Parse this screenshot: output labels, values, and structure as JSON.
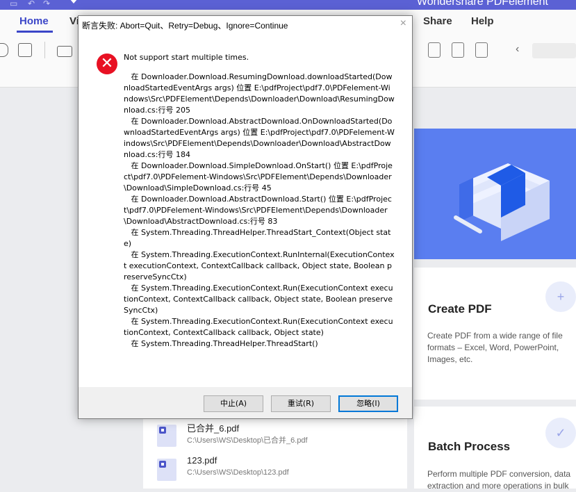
{
  "app": {
    "title": "Wondershare PDFelement"
  },
  "ribbon": {
    "tabs": [
      "Home",
      "Vi",
      "Share",
      "Help"
    ]
  },
  "recent_files": [
    {
      "name": "已合并_6.pdf",
      "path": "C:\\Users\\WS\\Desktop\\已合并_6.pdf"
    },
    {
      "name": "123.pdf",
      "path": "C:\\Users\\WS\\Desktop\\123.pdf"
    }
  ],
  "cards": {
    "create": {
      "title": "Create PDF",
      "desc": "Create PDF from a wide range of file formats – Excel, Word, PowerPoint, Images, etc."
    },
    "batch": {
      "title": "Batch Process",
      "desc": "Perform multiple PDF conversion, data extraction and more operations in bulk"
    }
  },
  "dialog": {
    "title": "断言失败: Abort=Quit、Retry=Debug、Ignore=Continue",
    "message": "Not support start multiple times.",
    "trace": "   在 Downloader.Download.ResumingDownload.downloadStarted(DownloadStartedEventArgs args) 位置 E:\\pdfProject\\pdf7.0\\PDFelement-Windows\\Src\\PDFElement\\Depends\\Downloader\\Download\\ResumingDownload.cs:行号 205\n   在 Downloader.Download.AbstractDownload.OnDownloadStarted(DownloadStartedEventArgs args) 位置 E:\\pdfProject\\pdf7.0\\PDFelement-Windows\\Src\\PDFElement\\Depends\\Downloader\\Download\\AbstractDownload.cs:行号 184\n   在 Downloader.Download.SimpleDownload.OnStart() 位置 E:\\pdfProject\\pdf7.0\\PDFelement-Windows\\Src\\PDFElement\\Depends\\Downloader\\Download\\SimpleDownload.cs:行号 45\n   在 Downloader.Download.AbstractDownload.Start() 位置 E:\\pdfProject\\pdf7.0\\PDFelement-Windows\\Src\\PDFElement\\Depends\\Downloader\\Download\\AbstractDownload.cs:行号 83\n   在 System.Threading.ThreadHelper.ThreadStart_Context(Object state)\n   在 System.Threading.ExecutionContext.RunInternal(ExecutionContext executionContext, ContextCallback callback, Object state, Boolean preserveSyncCtx)\n   在 System.Threading.ExecutionContext.Run(ExecutionContext executionContext, ContextCallback callback, Object state, Boolean preserveSyncCtx)\n   在 System.Threading.ExecutionContext.Run(ExecutionContext executionContext, ContextCallback callback, Object state)\n   在 System.Threading.ThreadHelper.ThreadStart()",
    "buttons": {
      "abort": "中止(A)",
      "retry": "重试(R)",
      "ignore": "忽略(I)"
    }
  },
  "icons": {
    "error": "error-x-icon",
    "close": "close-icon"
  },
  "colors": {
    "accent": "#3b46c8",
    "titlebar": "#5b61d4",
    "error": "#e81123",
    "default_button_border": "#0078d7"
  }
}
